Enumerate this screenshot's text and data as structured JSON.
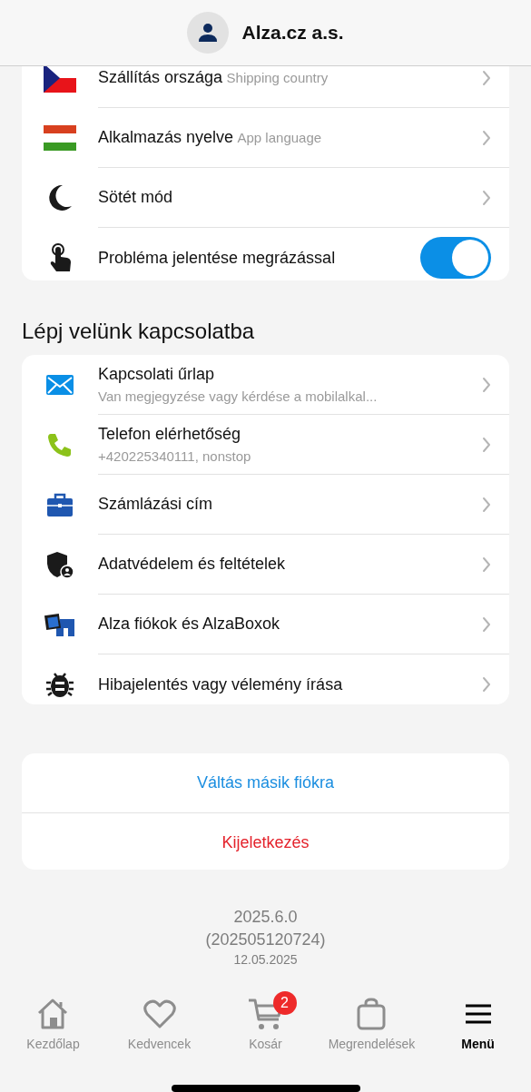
{
  "header": {
    "title": "Alza.cz a.s."
  },
  "settings_rows": [
    {
      "kind": "link",
      "label": "Szállítás országa",
      "hint": "Shipping country"
    },
    {
      "kind": "link",
      "label": "Alkalmazás nyelve",
      "hint": "App language"
    },
    {
      "kind": "link",
      "label": "Sötét mód"
    },
    {
      "kind": "toggle",
      "label": "Probléma jelentése megrázással",
      "on": true
    }
  ],
  "contact_section": {
    "title": "Lépj velünk kapcsolatba",
    "rows": [
      {
        "label": "Kapcsolati űrlap",
        "subtitle": "Van megjegyzése vagy kérdése a mobilalkal..."
      },
      {
        "label": "Telefon elérhetőség",
        "subtitle": "+420225340111, nonstop"
      },
      {
        "label": "Számlázási cím"
      },
      {
        "label": "Adatvédelem és feltételek"
      },
      {
        "label": "Alza fiókok és AlzaBoxok"
      },
      {
        "label": "Hibajelentés vagy vélemény írása"
      }
    ]
  },
  "account_actions": [
    {
      "kind": "primary",
      "label": "Váltás másik fiókra"
    },
    {
      "kind": "danger",
      "label": "Kijeletkezés"
    }
  ],
  "version": {
    "number": "2025.6.0",
    "build": "(202505120724)",
    "date": "12.05.2025"
  },
  "tab_bar": [
    {
      "label": "Kezdőlap",
      "selected": false
    },
    {
      "label": "Kedvencek",
      "selected": false
    },
    {
      "label": "Kosár",
      "selected": false,
      "badge": "2"
    },
    {
      "label": "Megrendelések",
      "selected": false
    },
    {
      "label": "Menü",
      "selected": true
    }
  ]
}
